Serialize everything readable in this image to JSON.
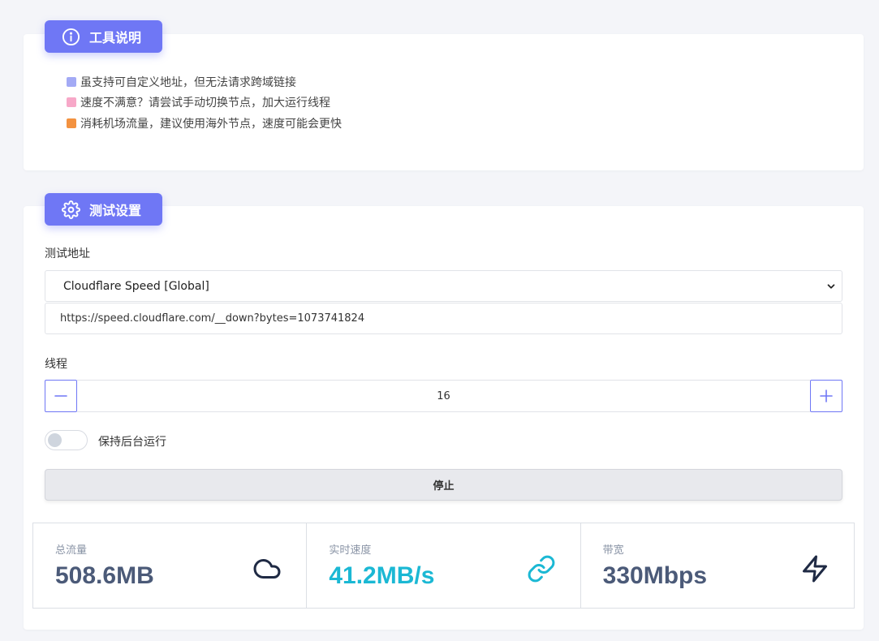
{
  "info": {
    "title": "工具说明",
    "notes": [
      {
        "text": "虽支持可自定义地址，但无法请求跨域链接",
        "color": "#a3aaf5"
      },
      {
        "text": "速度不满意？请尝试手动切换节点，加大运行线程",
        "color": "#f7a8c8"
      },
      {
        "text": "消耗机场流量，建议使用海外节点，速度可能会更快",
        "color": "#f39240"
      }
    ]
  },
  "settings": {
    "title": "测试设置",
    "url_label": "测试地址",
    "url_select_value": "Cloudflare Speed [Global]",
    "url_input_value": "https://speed.cloudflare.com/__down?bytes=1073741824",
    "threads_label": "线程",
    "threads_value": "16",
    "background_label": "保持后台运行",
    "background_on": false,
    "stop_label": "停止"
  },
  "stats": {
    "total": {
      "label": "总流量",
      "value": "508.6MB",
      "icon": "cloud-icon",
      "color": "#4b5a78"
    },
    "speed": {
      "label": "实时速度",
      "value": "41.2MB/s",
      "icon": "link-icon",
      "color": "#1bb8d4"
    },
    "bandwidth": {
      "label": "带宽",
      "value": "330Mbps",
      "icon": "lightning-icon",
      "color": "#4b5a78"
    }
  },
  "colors": {
    "accent": "#6f77f5",
    "background": "#f4f5f9",
    "card": "#ffffff"
  }
}
